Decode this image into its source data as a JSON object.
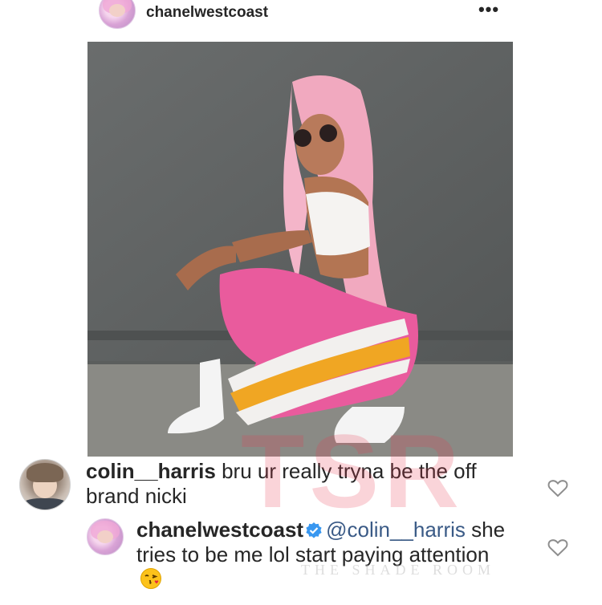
{
  "post": {
    "username": "chanelwestcoast",
    "more_icon_text": "•••"
  },
  "comments": [
    {
      "username": "colin__harris",
      "text": "bru ur really tryna be the off brand nicki"
    },
    {
      "username": "chanelwestcoast",
      "verified": true,
      "mention": "@colin__harris",
      "text": "she tries to be me lol start paying attention",
      "emoji": "face-blowing-kiss"
    }
  ],
  "watermark": {
    "letters": "TSR",
    "subtitle": "THE SHADE ROOM"
  },
  "colors": {
    "mention": "#3a5a86",
    "verified_badge": "#3897f0",
    "heart_outline": "#8e8e8e",
    "watermark": "#e63c50"
  },
  "icons": {
    "more": "more-horizontal-icon",
    "like": "heart-outline-icon",
    "verified": "verified-badge-icon"
  }
}
